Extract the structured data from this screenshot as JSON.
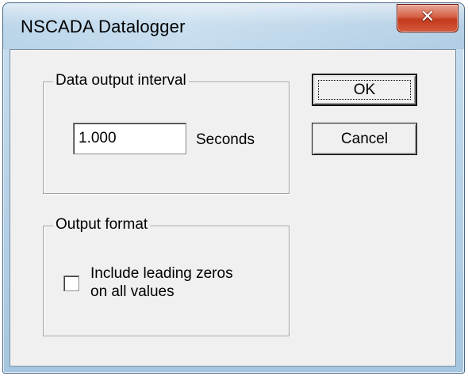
{
  "window": {
    "title": "NSCADA Datalogger",
    "close_glyph": "✕",
    "close_icon": "close-x-icon"
  },
  "interval_group": {
    "label": "Data output interval",
    "value": "1.000",
    "unit": "Seconds"
  },
  "format_group": {
    "label": "Output format",
    "checkbox_label_line1": "Include leading zeros",
    "checkbox_label_line2": "on all values",
    "checked": false
  },
  "buttons": {
    "ok_label": "OK",
    "cancel_label": "Cancel"
  },
  "colors": {
    "close_button": "#c84528",
    "dialog_face": "#f0f0f0",
    "title_glass": "#b9d4ea"
  }
}
